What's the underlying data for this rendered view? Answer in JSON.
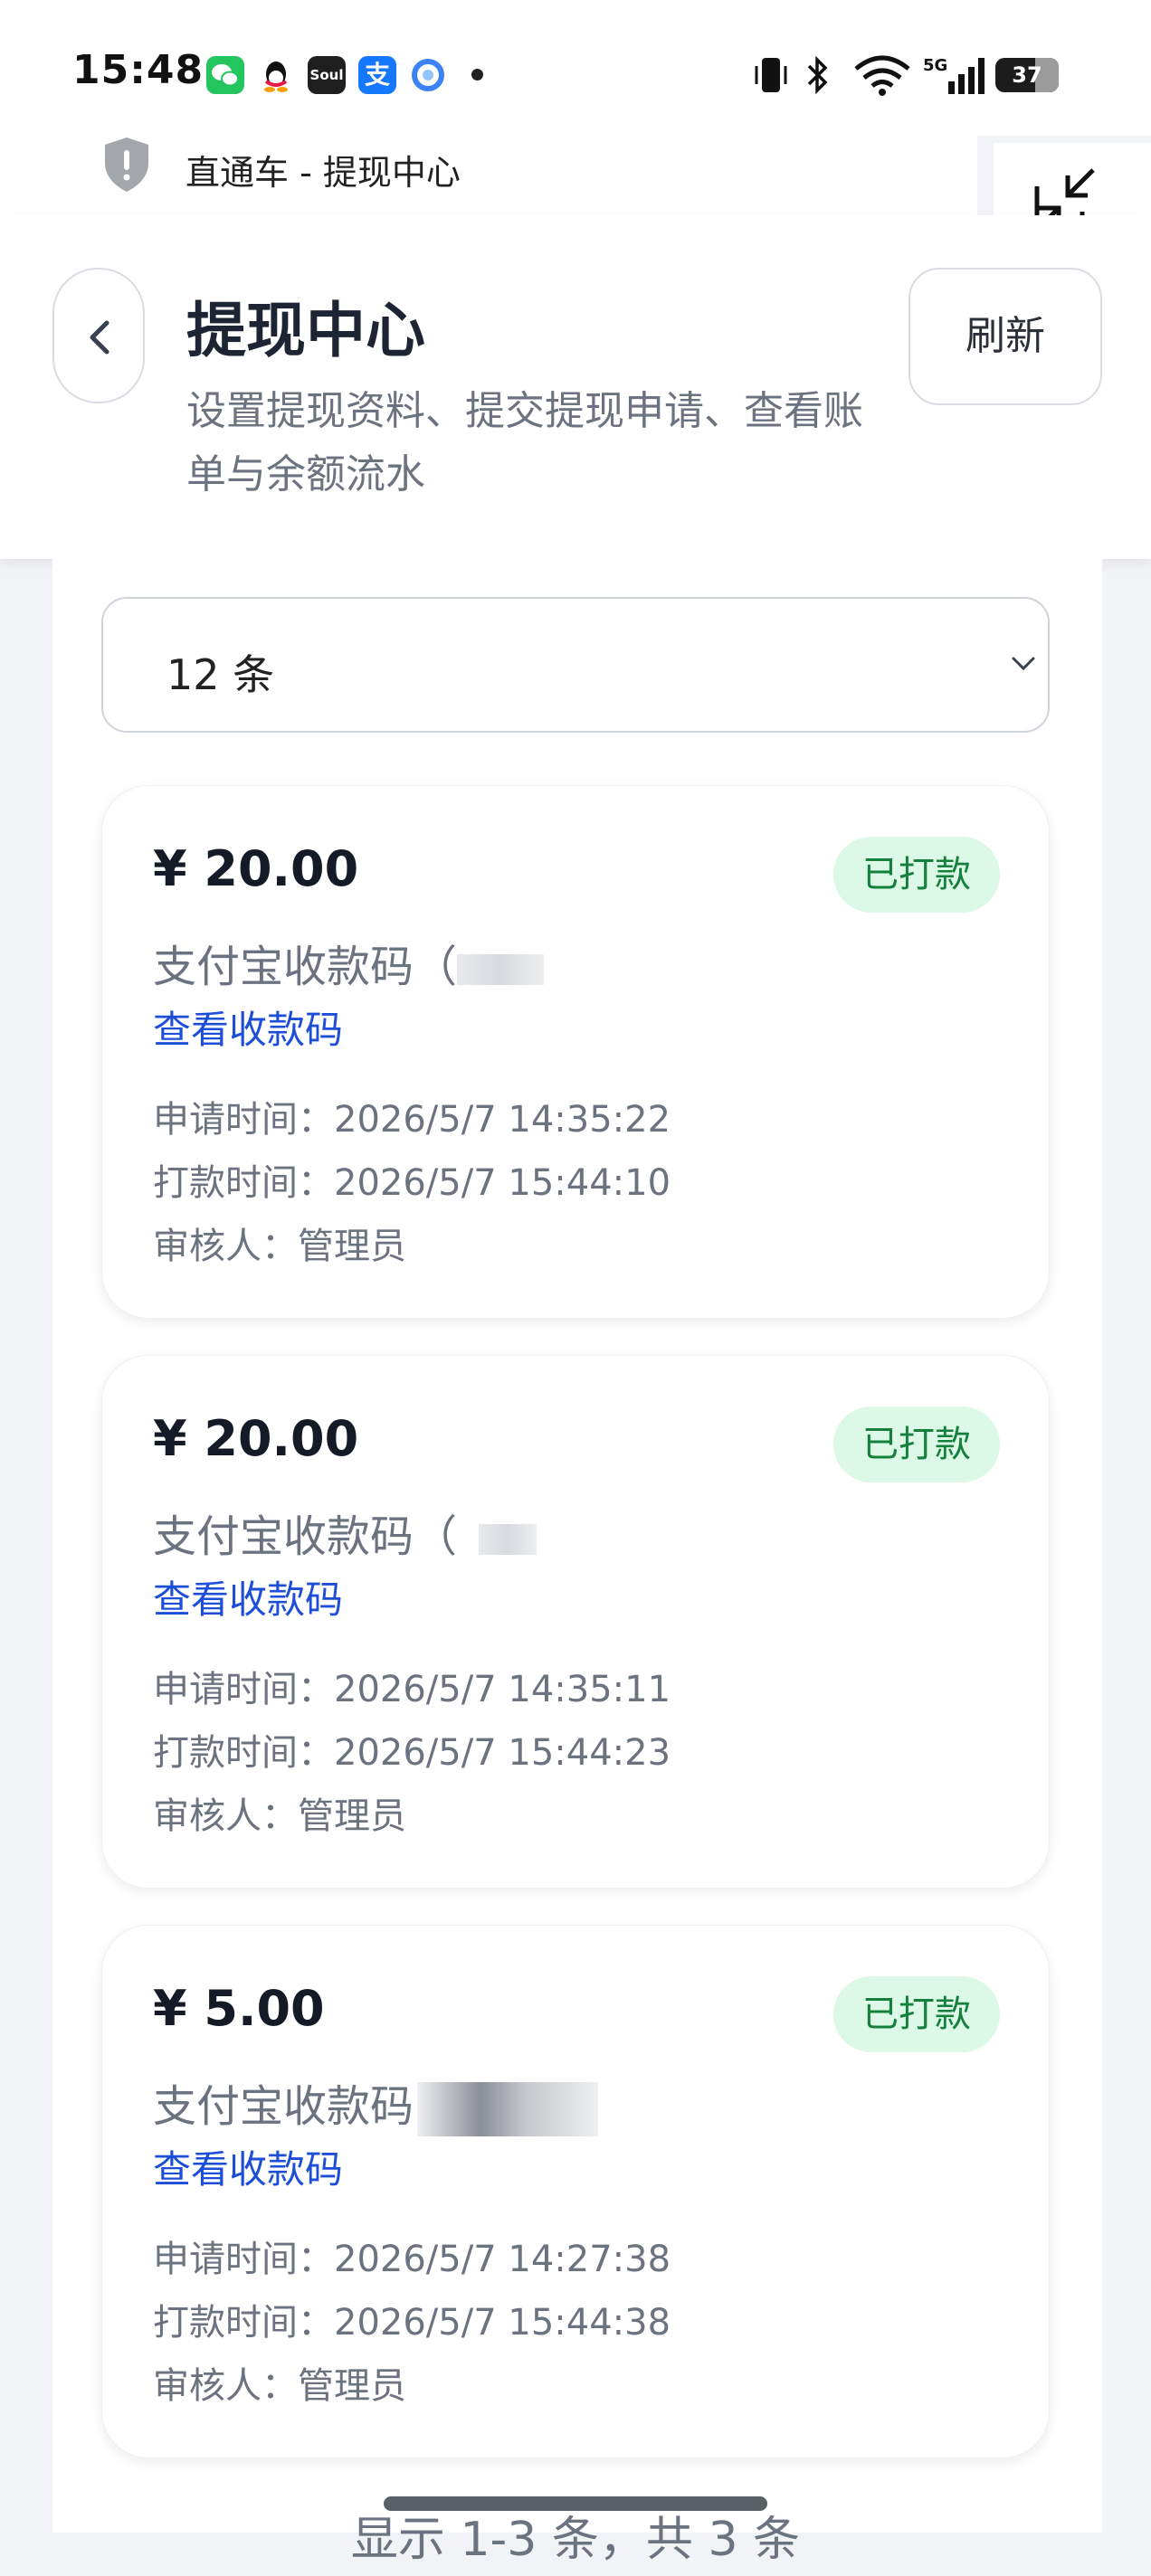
{
  "status_bar": {
    "time": "15:48",
    "app_icons": [
      "wechat-icon",
      "qq-icon",
      "soul-icon",
      "alipay-icon",
      "browser-icon"
    ],
    "soul_label": "Soul",
    "alipay_label": "支",
    "battery": "37",
    "network_label": "5G"
  },
  "browser": {
    "title": "直通车 - 提现中心"
  },
  "header": {
    "title": "提现中心",
    "subtitle": "设置提现资料、提交提现申请、查看账单与余额流水",
    "refresh_label": "刷新"
  },
  "filter": {
    "page_size": "12 条"
  },
  "records": [
    {
      "amount": "¥ 20.00",
      "status": "已打款",
      "channel": "支付宝收款码（",
      "view_link": "查看收款码",
      "apply_label": "申请时间：",
      "apply_time": "2026/5/7 14:35:22",
      "pay_label": "打款时间：",
      "pay_time": "2026/5/7 15:44:10",
      "reviewer_label": "审核人：",
      "reviewer": "管理员"
    },
    {
      "amount": "¥ 20.00",
      "status": "已打款",
      "channel": "支付宝收款码（",
      "view_link": "查看收款码",
      "apply_label": "申请时间：",
      "apply_time": "2026/5/7 14:35:11",
      "pay_label": "打款时间：",
      "pay_time": "2026/5/7 15:44:23",
      "reviewer_label": "审核人：",
      "reviewer": "管理员"
    },
    {
      "amount": "¥ 5.00",
      "status": "已打款",
      "channel": "支付宝收款码",
      "view_link": "查看收款码",
      "apply_label": "申请时间：",
      "apply_time": "2026/5/7 14:27:38",
      "pay_label": "打款时间：",
      "pay_time": "2026/5/7 15:44:38",
      "reviewer_label": "审核人：",
      "reviewer": "管理员"
    }
  ],
  "footer": {
    "summary": "显示 1-3 条，共 3 条"
  },
  "colors": {
    "accent_link": "#1d4ed8",
    "badge_bg": "#dcf8e6",
    "badge_text": "#15803d"
  }
}
